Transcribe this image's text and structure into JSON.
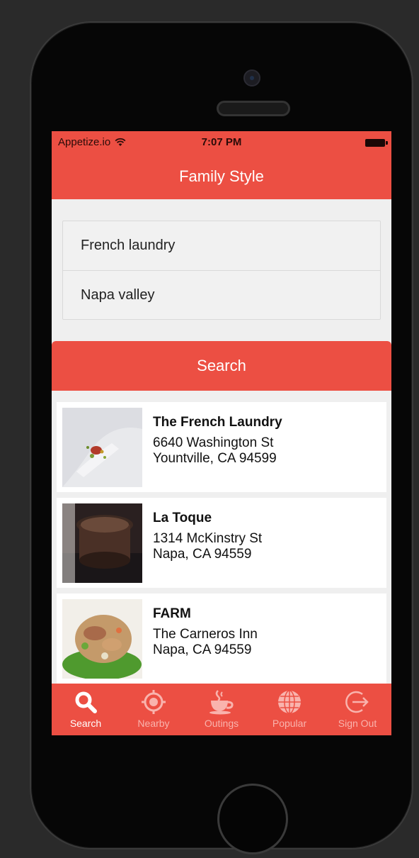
{
  "statusbar": {
    "carrier": "Appetize.io",
    "time": "7:07 PM"
  },
  "navbar": {
    "title": "Family Style"
  },
  "search": {
    "name_value": "French laundry",
    "location_value": "Napa valley",
    "button_label": "Search"
  },
  "results": [
    {
      "name": "The French Laundry",
      "line1": "6640 Washington St",
      "line2": "Yountville, CA 94599"
    },
    {
      "name": "La Toque",
      "line1": "1314 McKinstry St",
      "line2": "Napa, CA 94559"
    },
    {
      "name": "FARM",
      "line1": "The Carneros Inn",
      "line2": "Napa, CA 94559"
    }
  ],
  "tabs": [
    {
      "label": "Search",
      "icon": "search-icon",
      "active": true
    },
    {
      "label": "Nearby",
      "icon": "target-icon",
      "active": false
    },
    {
      "label": "Outings",
      "icon": "coffee-cup-icon",
      "active": false
    },
    {
      "label": "Popular",
      "icon": "globe-icon",
      "active": false
    },
    {
      "label": "Sign Out",
      "icon": "sign-out-icon",
      "active": false
    }
  ],
  "colors": {
    "accent": "#ec4f43",
    "background": "#efefef",
    "inactive_tab": "#f9b3ad"
  }
}
